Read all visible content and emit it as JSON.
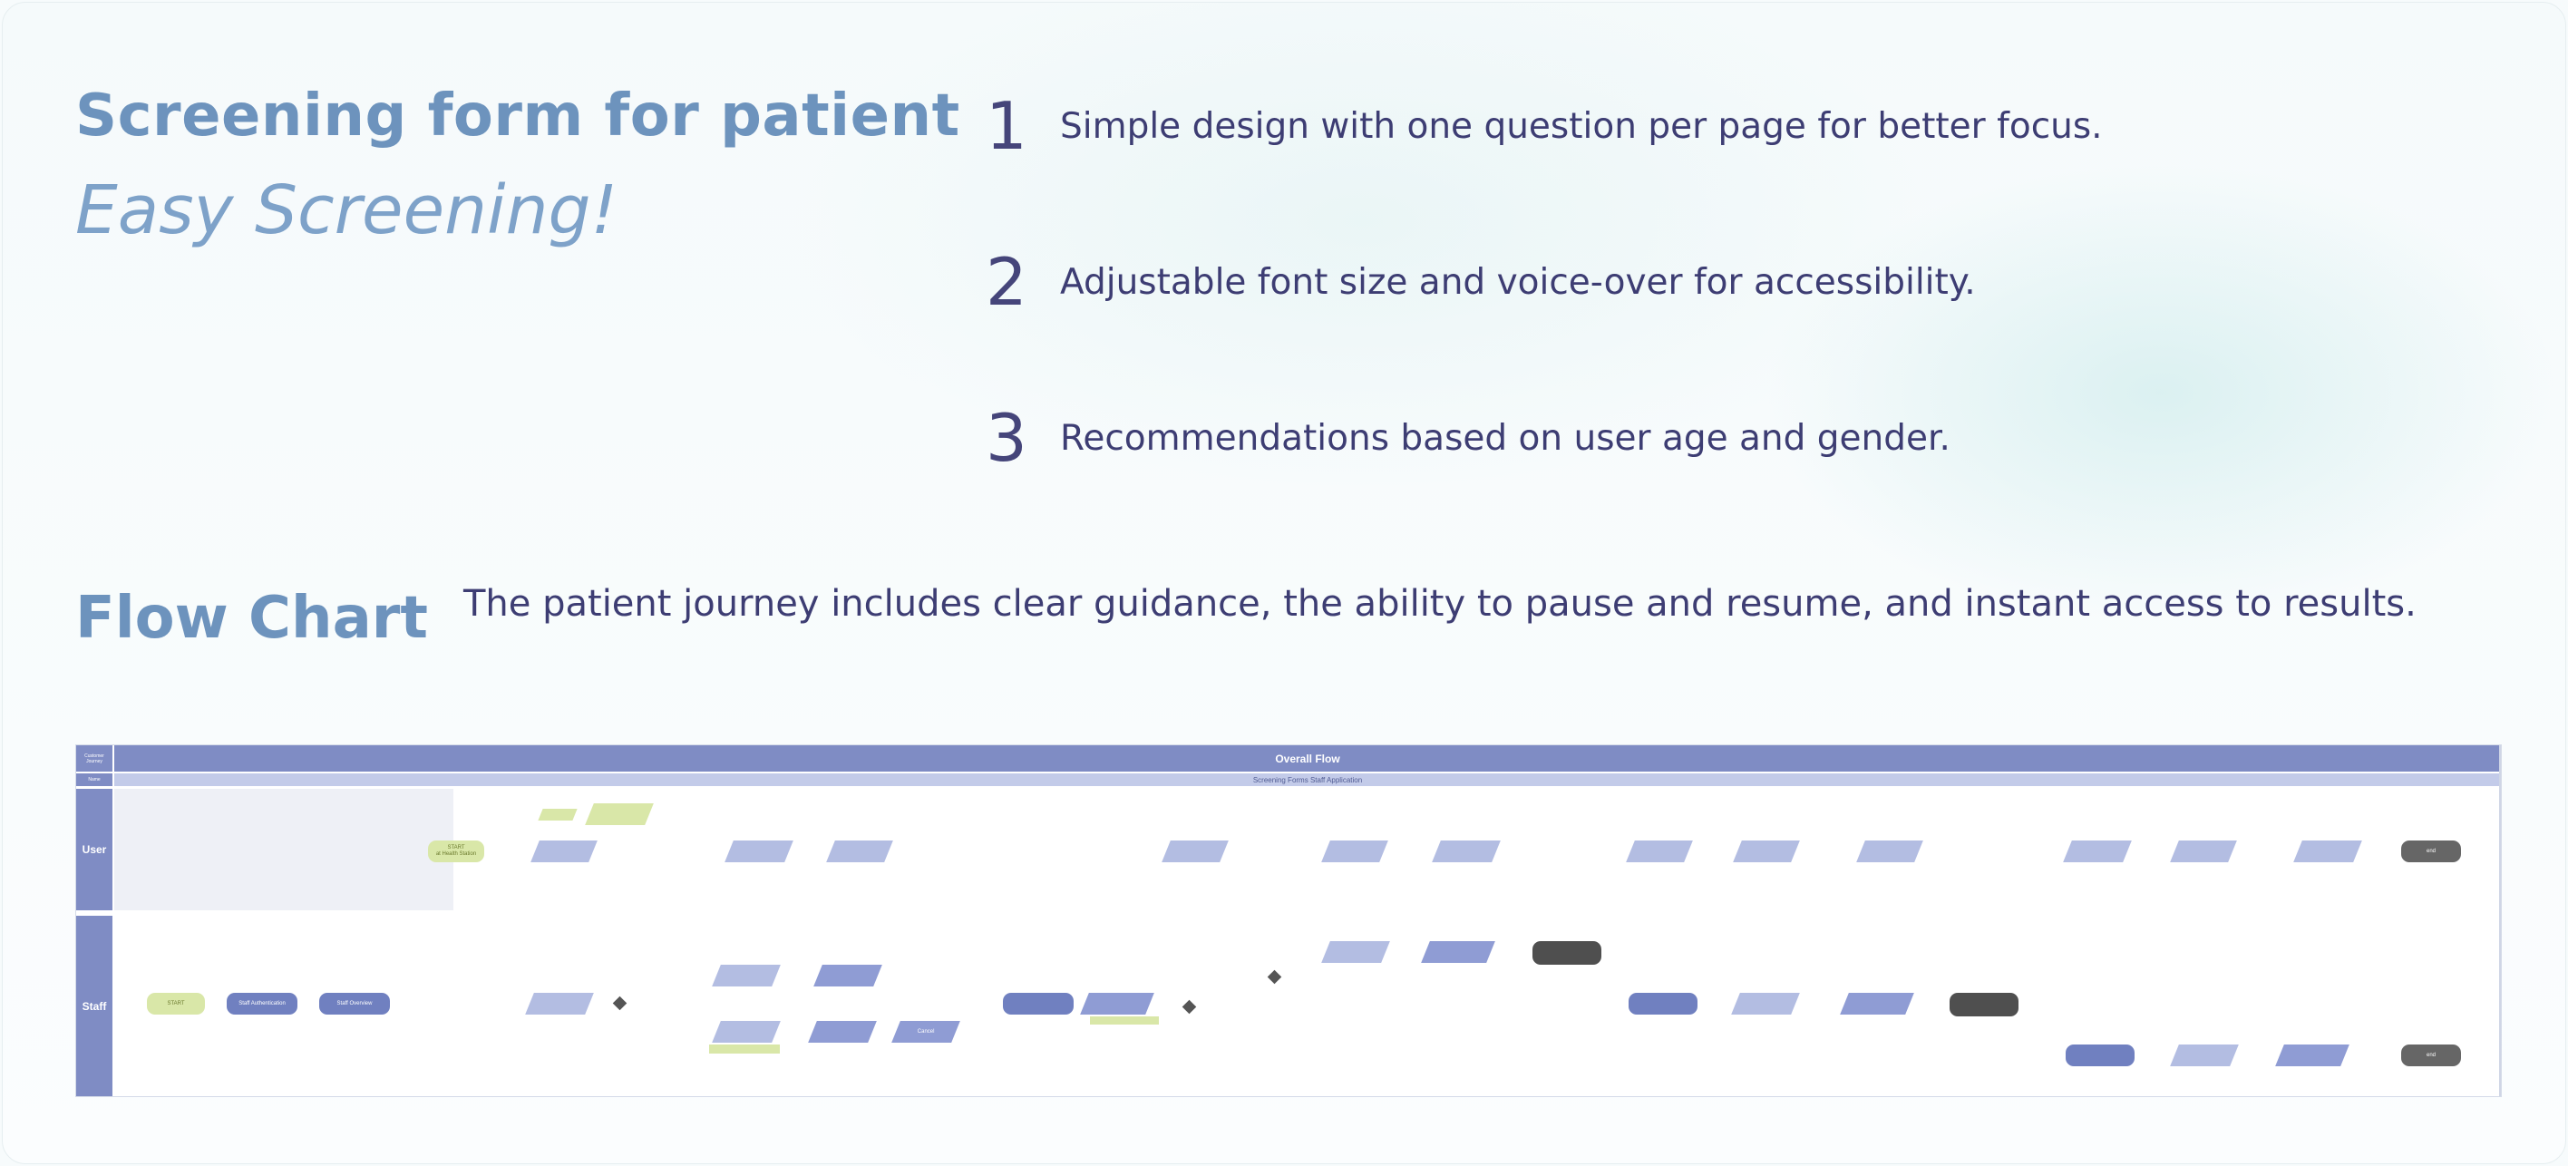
{
  "header": {
    "title": "Screening form for patient",
    "subtitle": "Easy Screening!"
  },
  "features": [
    {
      "number": "1",
      "text": "Simple design with one question per page for better focus."
    },
    {
      "number": "2",
      "text": "Adjustable font size and voice-over for accessibility."
    },
    {
      "number": "3",
      "text": "Recommendations based on user age and gender."
    }
  ],
  "flow": {
    "title": "Flow Chart",
    "description": "The patient journey includes clear guidance, the ability to pause and resume, and instant access to results."
  },
  "diagram": {
    "header_label_1": "Customer Journey",
    "header_label_2": "Name",
    "overall_title": "Overall Flow",
    "sub_title": "Screening Forms Staff Application",
    "lane_user": "User",
    "lane_staff": "Staff",
    "colors": {
      "lane_header": "#7f8cc4",
      "sub_bar": "#c3cbe9",
      "light_node": "#b3bde2",
      "mid_node": "#8f9cd4",
      "rounded_node": "#7080c0",
      "green_node": "#d9e7a8",
      "dark_node": "#666666"
    },
    "user_nodes": {
      "start": "START",
      "start_sub": "at Health Station",
      "end_1": "end",
      "end_2": "end"
    },
    "staff_nodes": {
      "start": "START",
      "auth": "Staff Authentication",
      "overview": "Staff Overview",
      "cancel": "Cancel"
    }
  }
}
